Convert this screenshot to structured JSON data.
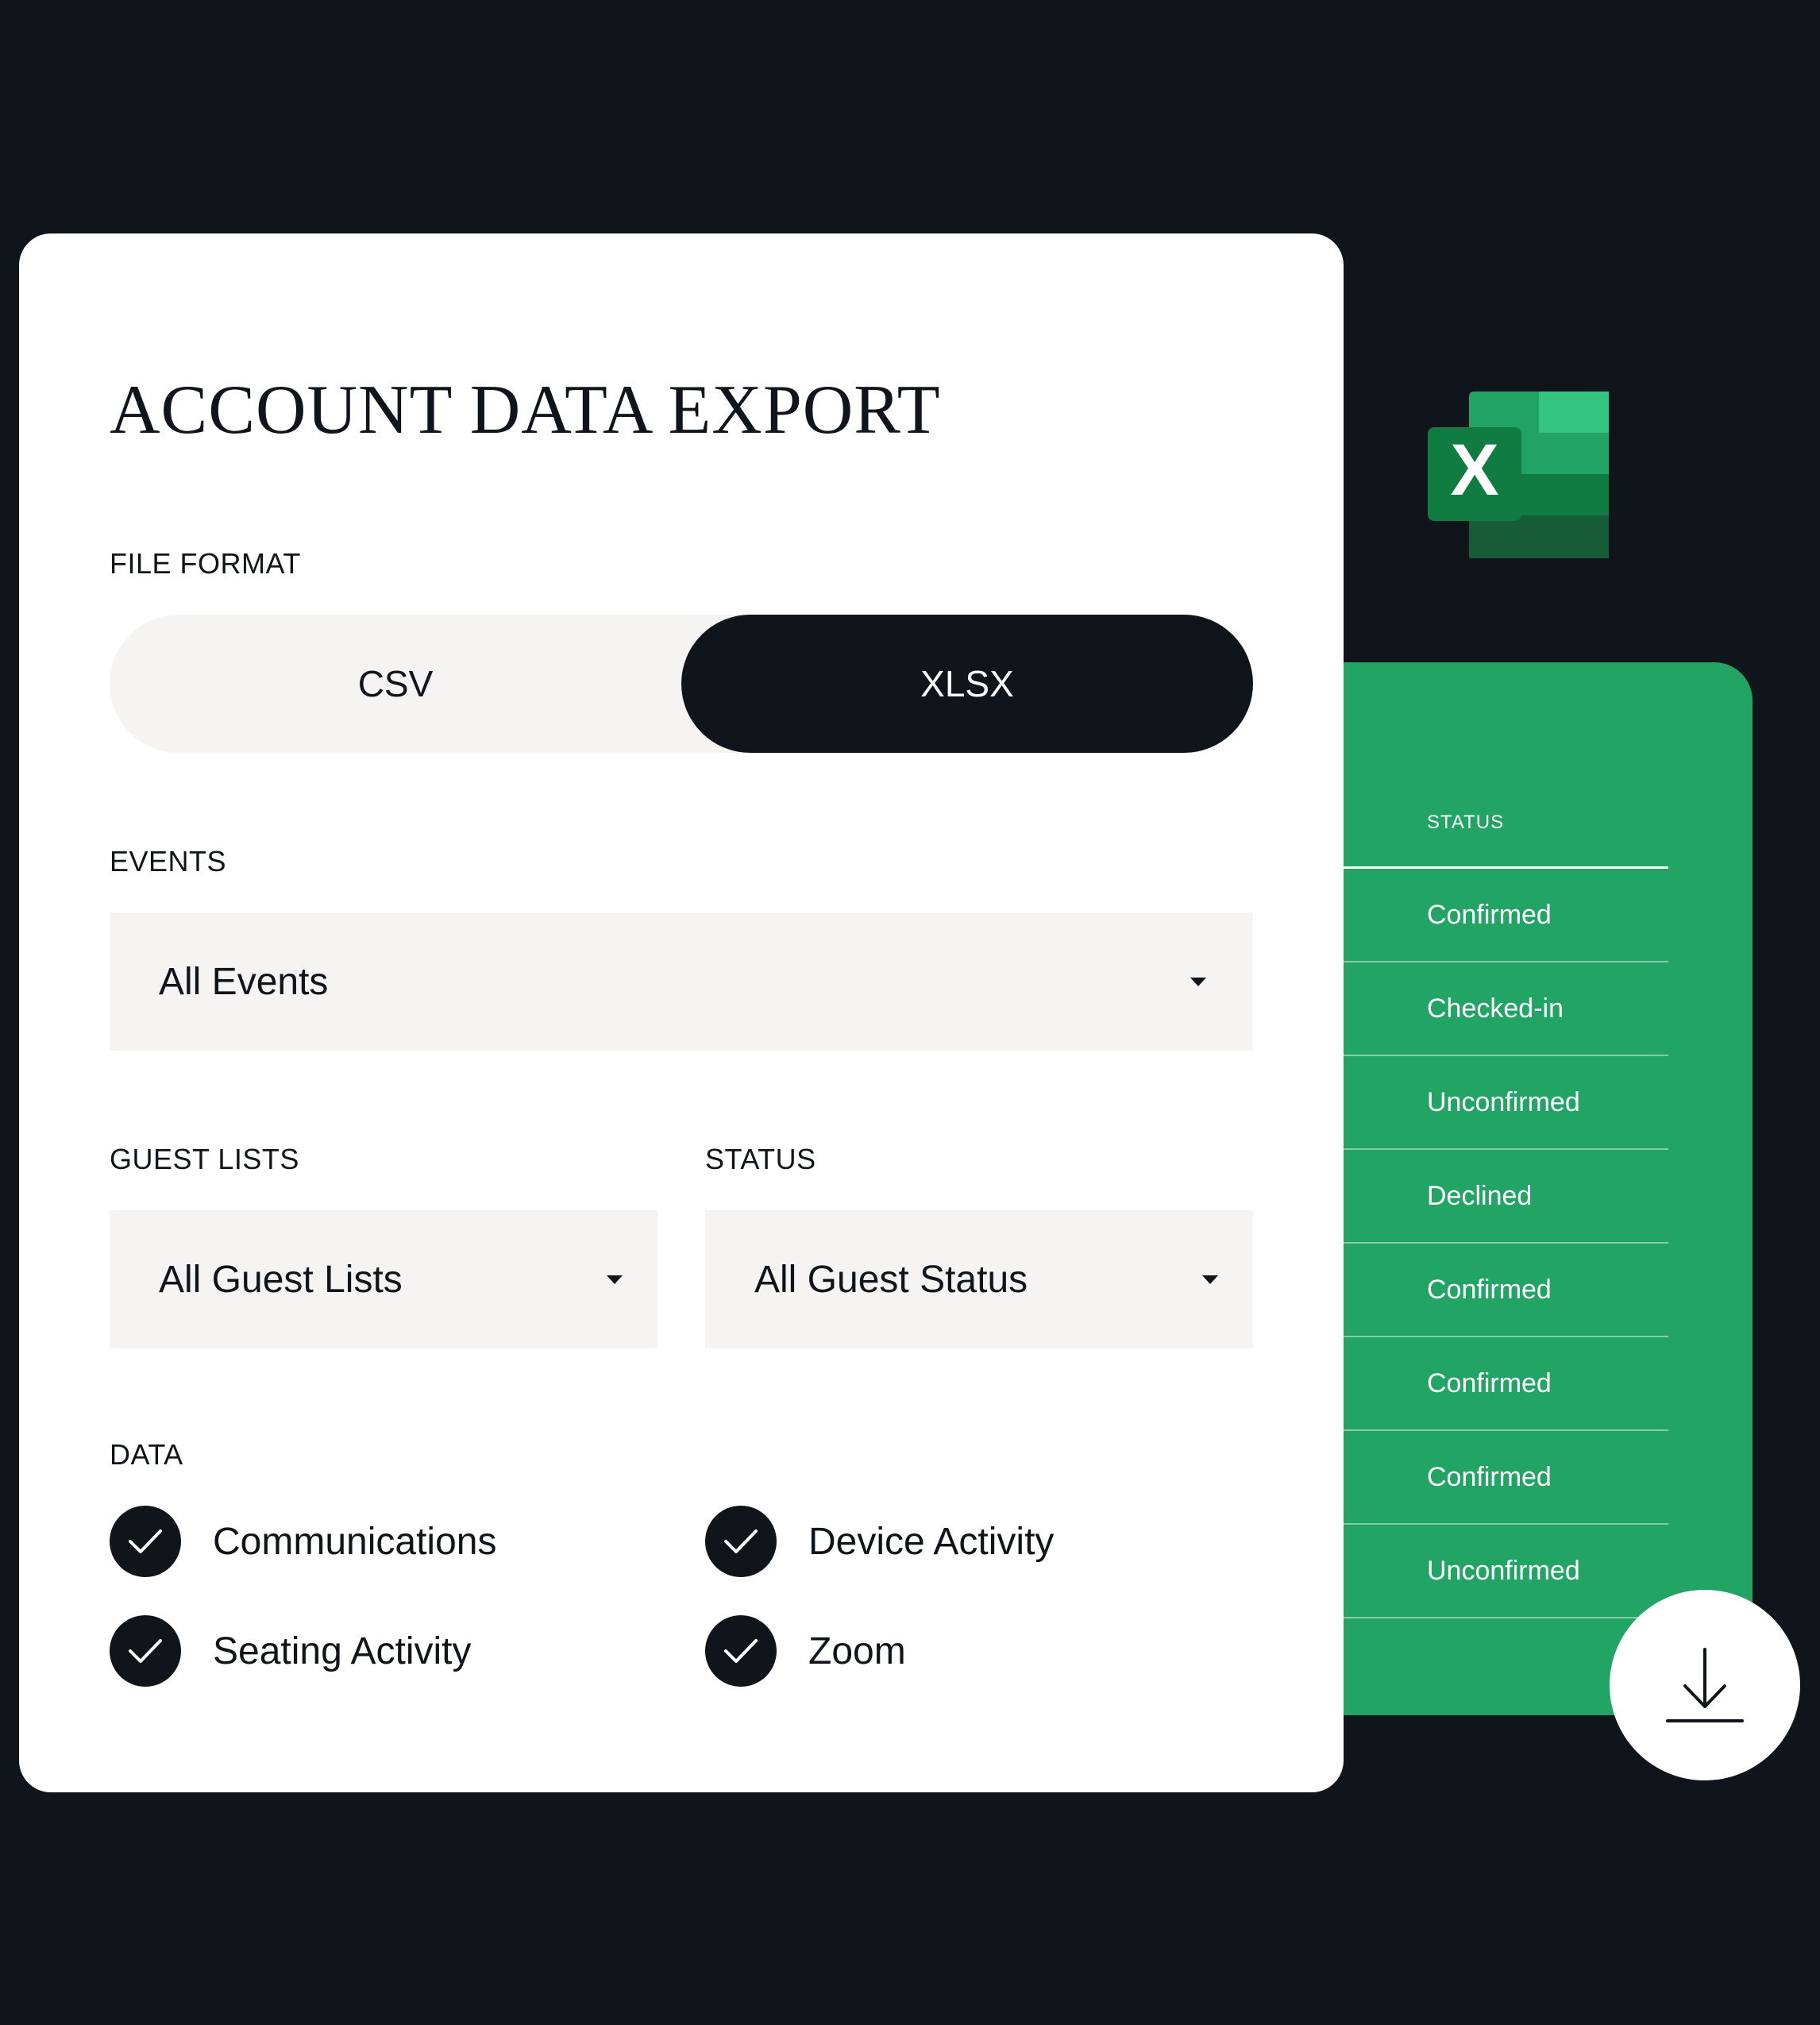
{
  "export_card": {
    "title": "ACCOUNT DATA EXPORT",
    "file_format": {
      "label": "FILE FORMAT",
      "options": [
        "CSV",
        "XLSX"
      ],
      "selected": "XLSX"
    },
    "events": {
      "label": "EVENTS",
      "value": "All Events"
    },
    "guest_lists": {
      "label": "GUEST LISTS",
      "value": "All Guest Lists"
    },
    "status": {
      "label": "STATUS",
      "value": "All Guest Status"
    },
    "data": {
      "label": "DATA",
      "items": [
        {
          "label": "Communications",
          "checked": true
        },
        {
          "label": "Device Activity",
          "checked": true
        },
        {
          "label": "Seating Activity",
          "checked": true
        },
        {
          "label": "Zoom",
          "checked": true
        }
      ]
    }
  },
  "spreadsheet": {
    "header": "STATUS",
    "rows": [
      "Confirmed",
      "Checked-in",
      "Unconfirmed",
      "Declined",
      "Confirmed",
      "Confirmed",
      "Confirmed",
      "Unconfirmed"
    ]
  },
  "icons": {
    "app_icon": "excel-icon",
    "download": "download-icon",
    "check": "checkmark-icon",
    "caret": "caret-down-icon"
  },
  "colors": {
    "background": "#10141b",
    "card": "#ffffff",
    "sheet_green": "#22a564",
    "field_bg": "#f5f4f2",
    "selected_segment": "#10141b"
  }
}
